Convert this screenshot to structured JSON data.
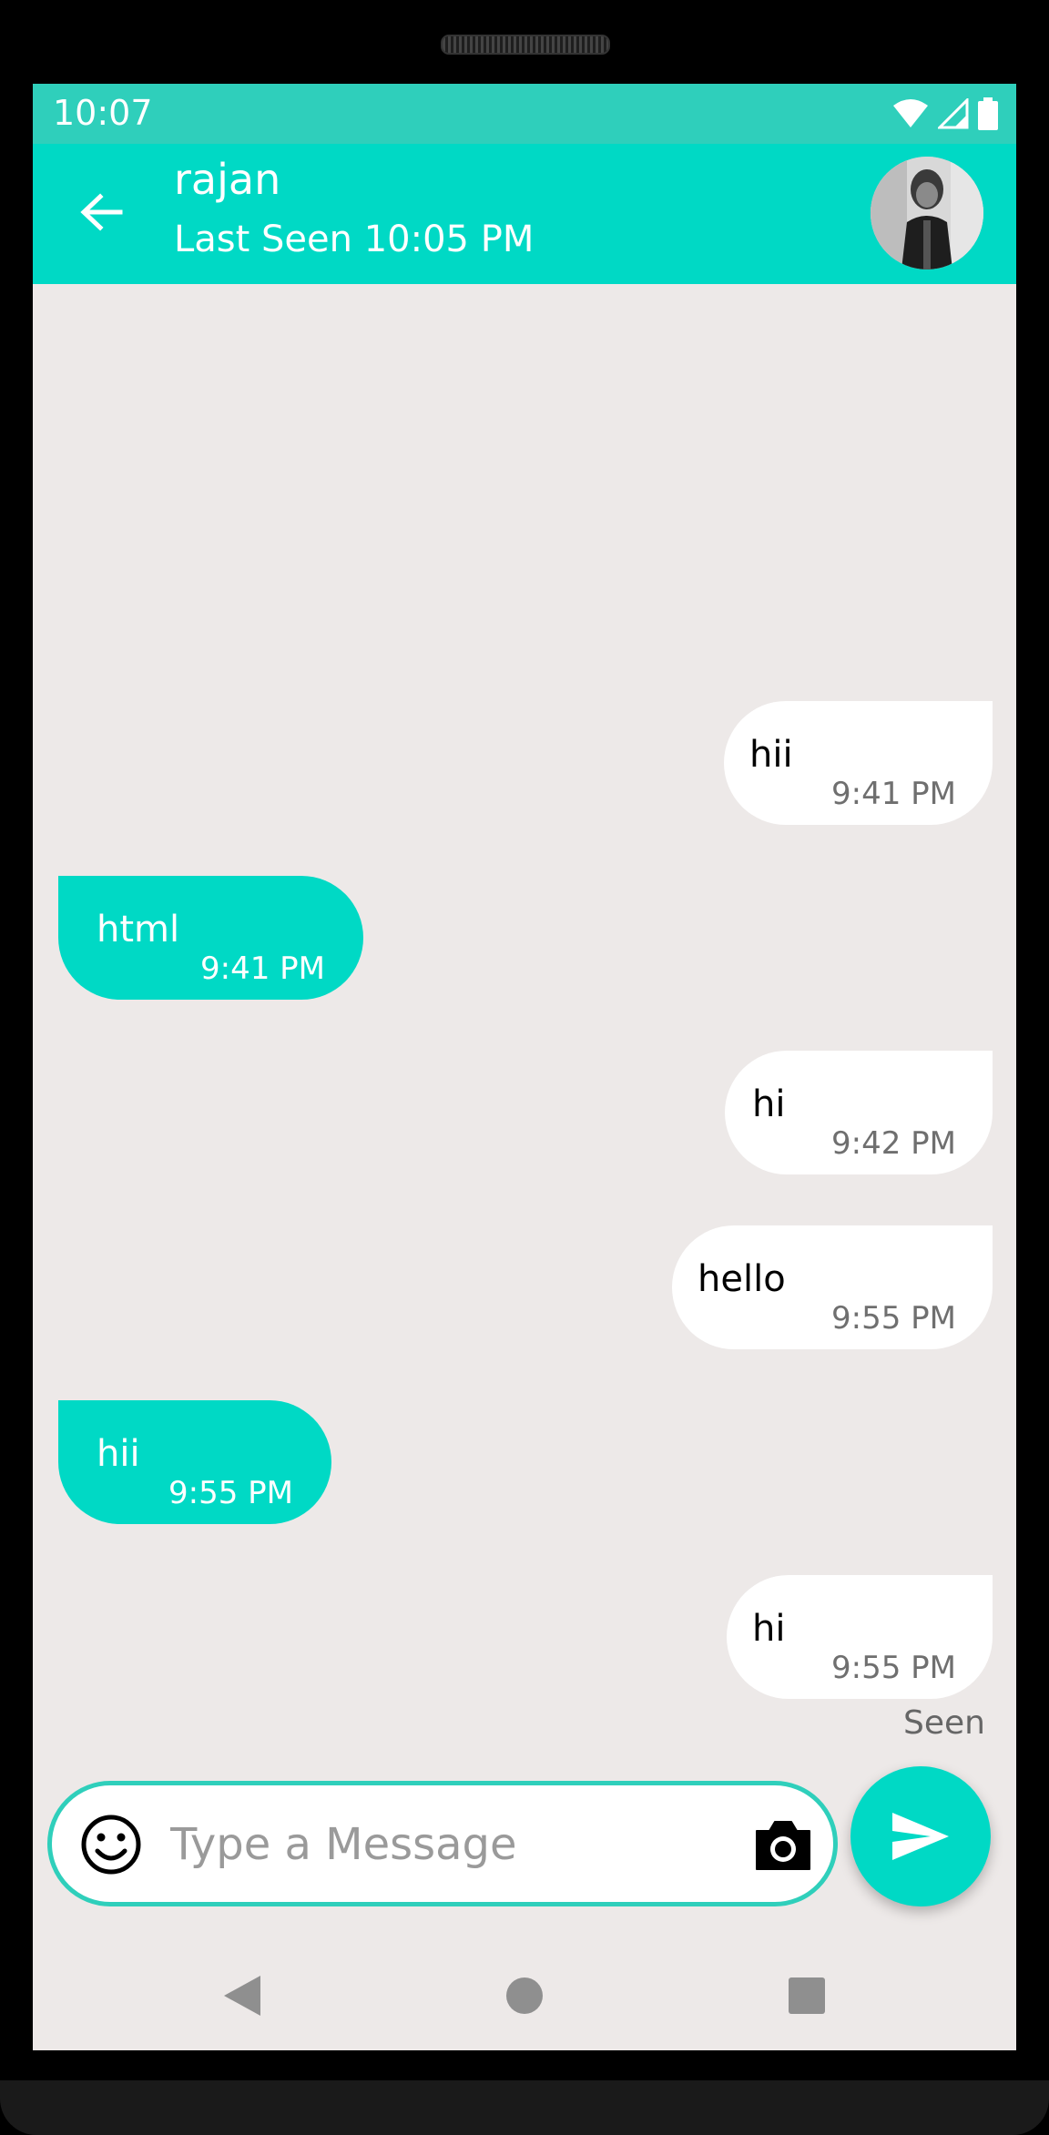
{
  "status_bar": {
    "time": "10:07"
  },
  "app_bar": {
    "contact_name": "rajan",
    "last_seen": "Last Seen 10:05 PM"
  },
  "messages": [
    {
      "direction": "out",
      "text": "hii",
      "time": "9:41 PM"
    },
    {
      "direction": "in",
      "text": "html",
      "time": "9:41 PM"
    },
    {
      "direction": "out",
      "text": "hi",
      "time": "9:42 PM"
    },
    {
      "direction": "out",
      "text": "hello",
      "time": "9:55 PM"
    },
    {
      "direction": "in",
      "text": "hii",
      "time": "9:55 PM"
    },
    {
      "direction": "out",
      "text": "hi",
      "time": "9:55 PM"
    }
  ],
  "seen_label": "Seen",
  "composer": {
    "placeholder": "Type a Message"
  },
  "colors": {
    "accent": "#00d9c5",
    "status_bar": "#2fcfbb",
    "chat_background": "#ede9e8",
    "outgoing_bubble": "#ffffff"
  },
  "icons": {
    "back": "arrow-left-icon",
    "emoji": "smiley-icon",
    "camera": "camera-icon",
    "send": "send-icon",
    "nav_back": "triangle-back-icon",
    "nav_home": "circle-home-icon",
    "nav_recents": "square-recents-icon"
  }
}
